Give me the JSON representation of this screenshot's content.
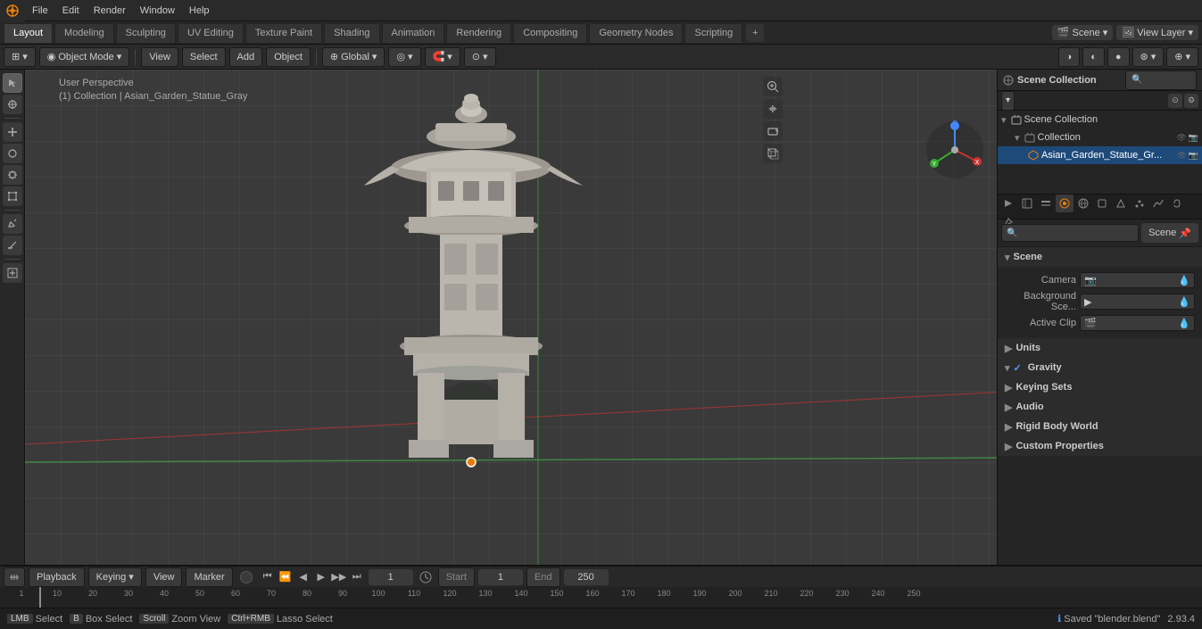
{
  "app": {
    "title": "Blender",
    "version": "2.93.4"
  },
  "topMenu": {
    "items": [
      "File",
      "Edit",
      "Render",
      "Window",
      "Help"
    ]
  },
  "workspaceTabs": {
    "tabs": [
      {
        "label": "Layout",
        "active": true
      },
      {
        "label": "Modeling",
        "active": false
      },
      {
        "label": "Sculpting",
        "active": false
      },
      {
        "label": "UV Editing",
        "active": false
      },
      {
        "label": "Texture Paint",
        "active": false
      },
      {
        "label": "Shading",
        "active": false
      },
      {
        "label": "Animation",
        "active": false
      },
      {
        "label": "Rendering",
        "active": false
      },
      {
        "label": "Compositing",
        "active": false
      },
      {
        "label": "Geometry Nodes",
        "active": false
      },
      {
        "label": "Scripting",
        "active": false
      }
    ],
    "addLabel": "+",
    "sceneLabel": "Scene",
    "viewLayerLabel": "View Layer"
  },
  "viewport": {
    "header": {
      "modeLabel": "Object Mode",
      "viewLabel": "View",
      "selectLabel": "Select",
      "addLabel": "Add",
      "objectLabel": "Object",
      "transformLabel": "Global",
      "pivotLabel": "↻"
    },
    "info": {
      "line1": "User Perspective",
      "line2": "(1) Collection | Asian_Garden_Statue_Gray"
    }
  },
  "leftToolbar": {
    "tools": [
      {
        "icon": "↕",
        "name": "select-tool",
        "active": true
      },
      {
        "icon": "⊕",
        "name": "cursor-tool"
      },
      {
        "icon": "⤢",
        "name": "move-tool"
      },
      {
        "icon": "↺",
        "name": "rotate-tool"
      },
      {
        "icon": "⊞",
        "name": "scale-tool"
      },
      {
        "icon": "⛶",
        "name": "transform-tool"
      },
      {
        "sep": true
      },
      {
        "icon": "✏",
        "name": "annotate-tool"
      },
      {
        "icon": "📐",
        "name": "measure-tool"
      },
      {
        "sep": true
      },
      {
        "icon": "▱",
        "name": "add-tool"
      }
    ]
  },
  "navGizmos": {
    "buttons": [
      {
        "icon": "🔍",
        "name": "zoom-gizmo"
      },
      {
        "icon": "✋",
        "name": "pan-gizmo"
      },
      {
        "icon": "📷",
        "name": "camera-gizmo"
      },
      {
        "icon": "🔲",
        "name": "perspective-gizmo"
      }
    ]
  },
  "outliner": {
    "title": "Scene Collection",
    "items": [
      {
        "level": 0,
        "icon": "▾",
        "type": "collection",
        "name": "Collection",
        "expanded": true
      },
      {
        "level": 1,
        "icon": "▾",
        "type": "mesh",
        "name": "Asian_Garden_Statue_Gr...",
        "selected": true
      }
    ]
  },
  "propertiesTabs": {
    "tabs": [
      {
        "icon": "🎬",
        "name": "render-tab"
      },
      {
        "icon": "⚙",
        "name": "output-tab"
      },
      {
        "icon": "👁",
        "name": "view-layer-tab"
      },
      {
        "icon": "🌐",
        "name": "scene-tab",
        "active": true
      },
      {
        "icon": "🌍",
        "name": "world-tab"
      },
      {
        "icon": "◼",
        "name": "object-tab"
      },
      {
        "icon": "✦",
        "name": "modifier-tab"
      },
      {
        "icon": "⚡",
        "name": "particles-tab"
      },
      {
        "icon": "💧",
        "name": "physics-tab"
      },
      {
        "icon": "🔗",
        "name": "constraints-tab"
      },
      {
        "icon": "△",
        "name": "data-tab"
      },
      {
        "icon": "◈",
        "name": "material-tab"
      }
    ]
  },
  "sceneProperties": {
    "panelTitle": "Scene",
    "sections": {
      "scene": {
        "title": "Scene",
        "expanded": true,
        "fields": [
          {
            "label": "Camera",
            "value": "",
            "icon": "📷"
          },
          {
            "label": "Background Sce...",
            "value": "",
            "icon": "▶"
          },
          {
            "label": "Active Clip",
            "value": "",
            "icon": "🎬"
          }
        ]
      },
      "units": {
        "title": "Units",
        "expanded": false
      },
      "gravity": {
        "title": "Gravity",
        "expanded": true,
        "checked": true
      },
      "keyingSets": {
        "title": "Keying Sets",
        "expanded": false
      },
      "audio": {
        "title": "Audio",
        "expanded": false
      },
      "rigidBodyWorld": {
        "title": "Rigid Body World",
        "expanded": false
      },
      "customProperties": {
        "title": "Custom Properties",
        "expanded": false
      }
    }
  },
  "timeline": {
    "playbackLabel": "Playback",
    "keyingLabel": "Keying",
    "viewLabel": "View",
    "markerLabel": "Marker",
    "frameStart": "1",
    "currentFrame": "1",
    "startLabel": "Start",
    "startValue": "1",
    "endLabel": "End",
    "endValue": "250",
    "numbers": [
      "10",
      "20",
      "30",
      "40",
      "50",
      "60",
      "70",
      "80",
      "90",
      "100",
      "110",
      "120",
      "130",
      "140",
      "150",
      "160",
      "170",
      "180",
      "190",
      "200",
      "210",
      "220",
      "230",
      "240",
      "250"
    ]
  },
  "statusBar": {
    "select": "Select",
    "boxSelect": "Box Select",
    "zoomView": "Zoom View",
    "lassoSelect": "Lasso Select",
    "savedFile": "Saved \"blender.blend\"",
    "version": "2.93.4"
  }
}
